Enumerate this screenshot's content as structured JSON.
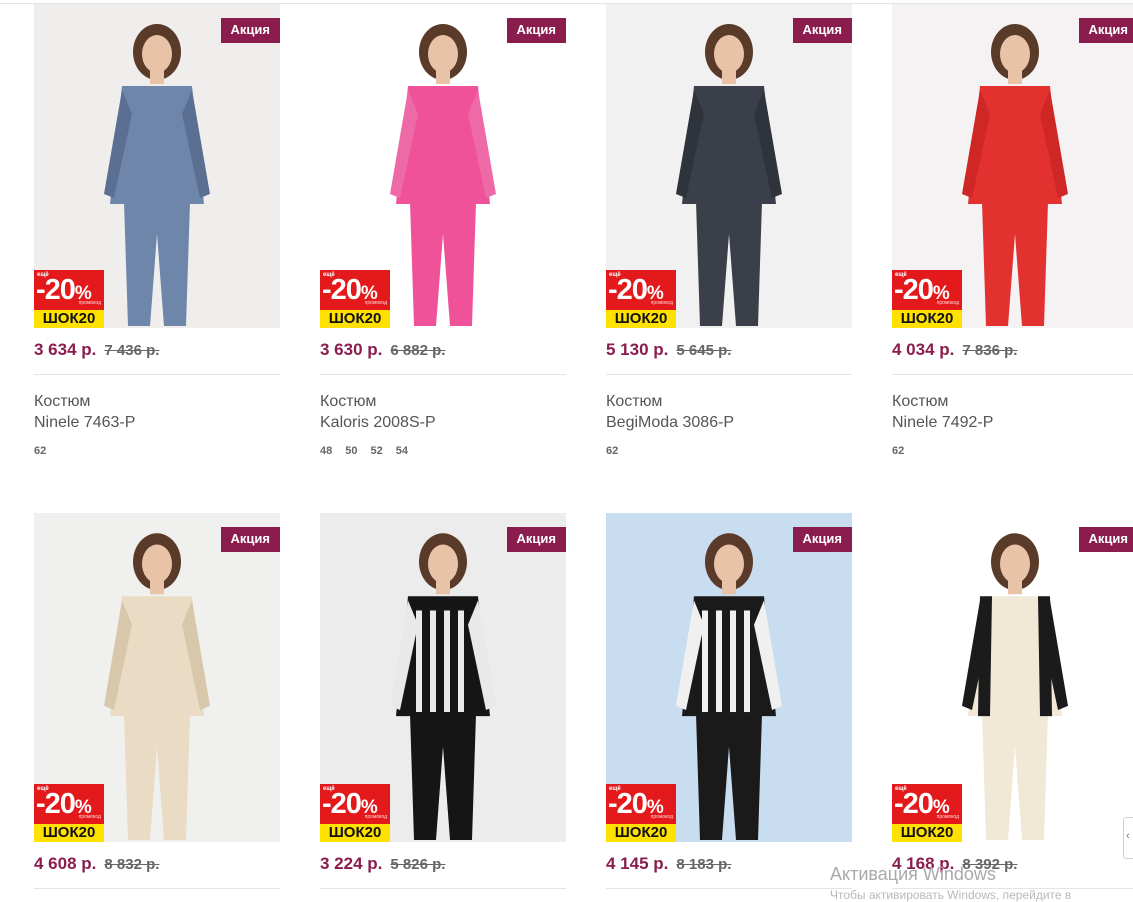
{
  "promo_label": "Акция",
  "discount": {
    "small_top": "ещё",
    "percent": "-20",
    "percent_sign": "%",
    "small_note": "промокод",
    "code": "ШОК20"
  },
  "products": [
    {
      "price": "3 634 р.",
      "old_price": "7 436 р.",
      "category": "Костюм",
      "model": "Ninele 7463-Р",
      "sizes": [
        "62"
      ],
      "colors": {
        "bg": "#efeeec",
        "garment": "#6f86ab",
        "accent": "#5a6f92"
      }
    },
    {
      "price": "3 630 р.",
      "old_price": "6 882 р.",
      "category": "Костюм",
      "model": "Kaloris 2008S-P",
      "sizes": [
        "48",
        "50",
        "52",
        "54"
      ],
      "colors": {
        "bg": "#ffffff",
        "garment": "#f0529a",
        "accent": "#ee6aa7"
      }
    },
    {
      "price": "5 130 р.",
      "old_price": "5 645 р.",
      "category": "Костюм",
      "model": "BegiModa 3086-Р",
      "sizes": [
        "62"
      ],
      "colors": {
        "bg": "#f1f1f1",
        "garment": "#3b3f4a",
        "accent": "#2f333c"
      }
    },
    {
      "price": "4 034 р.",
      "old_price": "7 836 р.",
      "category": "Костюм",
      "model": "Ninele 7492-Р",
      "sizes": [
        "62"
      ],
      "colors": {
        "bg": "#f4f2f2",
        "garment": "#e2312f",
        "accent": "#cf2726"
      }
    },
    {
      "price": "4 608 р.",
      "old_price": "8 832 р.",
      "category": "",
      "model": "",
      "sizes": [],
      "colors": {
        "bg": "#f0f0ef",
        "garment": "#eadbc4",
        "accent": "#d9c7ab"
      }
    },
    {
      "price": "3 224 р.",
      "old_price": "5 826 р.",
      "category": "",
      "model": "",
      "sizes": [],
      "colors": {
        "bg": "#ececec",
        "garment": "#151515",
        "accent": "#e9e9e9"
      }
    },
    {
      "price": "4 145 р.",
      "old_price": "8 183 р.",
      "category": "",
      "model": "",
      "sizes": [],
      "colors": {
        "bg": "#c9ddf0",
        "garment": "#1a1a1a",
        "accent": "#f0f0f0"
      }
    },
    {
      "price": "4 168 р.",
      "old_price": "8 392 р.",
      "category": "",
      "model": "",
      "sizes": [],
      "colors": {
        "bg": "#ffffff",
        "garment": "#f1e9d6",
        "accent": "#1b1b1b"
      }
    }
  ],
  "os_overlay": {
    "watermark_title": "Активация Windows",
    "watermark_sub": "Чтобы активировать Windows, перейдите в"
  }
}
